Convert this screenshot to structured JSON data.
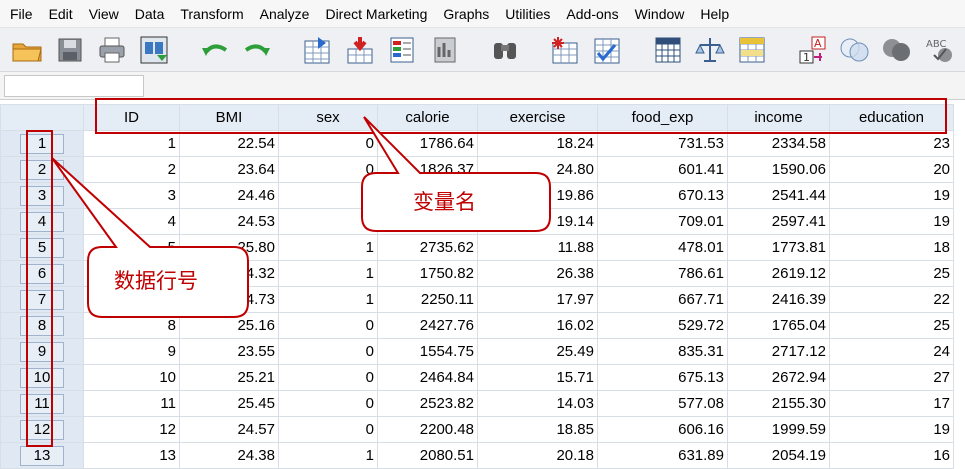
{
  "menu": [
    "File",
    "Edit",
    "View",
    "Data",
    "Transform",
    "Analyze",
    "Direct Marketing",
    "Graphs",
    "Utilities",
    "Add-ons",
    "Window",
    "Help"
  ],
  "toolbar_icons": [
    "open-folder-icon",
    "save-icon",
    "print-icon",
    "recall-dialog-icon",
    "undo-icon",
    "redo-icon",
    "goto-case-icon",
    "goto-variable-icon",
    "variables-icon",
    "run-descriptives-icon",
    "find-icon",
    "insert-cases-icon",
    "insert-variable-icon",
    "split-file-icon",
    "weight-cases-icon",
    "select-cases-icon",
    "value-labels-icon",
    "use-sets-icon",
    "show-all-variables-icon",
    "spelling-icon"
  ],
  "columns": [
    "ID",
    "BMI",
    "sex",
    "calorie",
    "exercise",
    "food_exp",
    "income",
    "education"
  ],
  "rows": [
    {
      "n": "1",
      "cells": [
        "1",
        "22.54",
        "0",
        "1786.64",
        "18.24",
        "731.53",
        "2334.58",
        "23"
      ]
    },
    {
      "n": "2",
      "cells": [
        "2",
        "23.64",
        "0",
        "1826.37",
        "24.80",
        "601.41",
        "1590.06",
        "20"
      ]
    },
    {
      "n": "3",
      "cells": [
        "3",
        "24.46",
        "",
        "",
        "19.86",
        "670.13",
        "2541.44",
        "19"
      ]
    },
    {
      "n": "4",
      "cells": [
        "4",
        "24.53",
        "",
        "",
        "19.14",
        "709.01",
        "2597.41",
        "19"
      ]
    },
    {
      "n": "5",
      "cells": [
        "5",
        "25.80",
        "1",
        "2735.62",
        "11.88",
        "478.01",
        "1773.81",
        "18"
      ]
    },
    {
      "n": "6",
      "cells": [
        "",
        "24.32",
        "1",
        "1750.82",
        "26.38",
        "786.61",
        "2619.12",
        "25"
      ]
    },
    {
      "n": "7",
      "cells": [
        "",
        "24.73",
        "1",
        "2250.11",
        "17.97",
        "667.71",
        "2416.39",
        "22"
      ]
    },
    {
      "n": "8",
      "cells": [
        "8",
        "25.16",
        "0",
        "2427.76",
        "16.02",
        "529.72",
        "1765.04",
        "25"
      ]
    },
    {
      "n": "9",
      "cells": [
        "9",
        "23.55",
        "0",
        "1554.75",
        "25.49",
        "835.31",
        "2717.12",
        "24"
      ]
    },
    {
      "n": "10",
      "cells": [
        "10",
        "25.21",
        "0",
        "2464.84",
        "15.71",
        "675.13",
        "2672.94",
        "27"
      ]
    },
    {
      "n": "11",
      "cells": [
        "11",
        "25.45",
        "0",
        "2523.82",
        "14.03",
        "577.08",
        "2155.30",
        "17"
      ]
    },
    {
      "n": "12",
      "cells": [
        "12",
        "24.57",
        "0",
        "2200.48",
        "18.85",
        "606.16",
        "1999.59",
        "19"
      ]
    },
    {
      "n": "13",
      "cells": [
        "13",
        "24.38",
        "1",
        "2080.51",
        "20.18",
        "631.89",
        "2054.19",
        "16"
      ]
    }
  ],
  "callouts": {
    "variable_name": "变量名",
    "row_number": "数据行号"
  },
  "colors": {
    "annotation": "#c00000",
    "header_bg": "#e4ecf6",
    "callout_fill": "#ffffff"
  }
}
